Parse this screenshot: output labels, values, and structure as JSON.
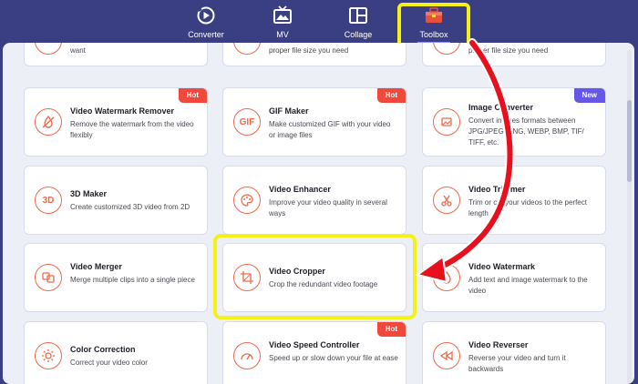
{
  "nav": {
    "items": [
      {
        "label": "Converter",
        "icon": "converter-icon"
      },
      {
        "label": "MV",
        "icon": "mv-icon"
      },
      {
        "label": "Collage",
        "icon": "collage-icon"
      },
      {
        "label": "Toolbox",
        "icon": "toolbox-icon",
        "active": true
      }
    ]
  },
  "top_row": [
    {
      "desc": "want"
    },
    {
      "desc": "proper file size you need"
    },
    {
      "desc": "proper file size you need"
    }
  ],
  "tools": [
    {
      "title": "Video Watermark Remover",
      "desc": "Remove the watermark from the video flexibly",
      "badge": "Hot",
      "icon": "watermark-remover-icon"
    },
    {
      "title": "GIF Maker",
      "desc": "Make customized GIF with your video or image files",
      "badge": "Hot",
      "icon": "gif-icon"
    },
    {
      "title": "Image Converter",
      "desc": "Convert images formats between JPG/JPEG, PNG, WEBP, BMP, TIF/ TIFF, etc.",
      "badge": "New",
      "icon": "image-converter-icon"
    },
    {
      "title": "3D Maker",
      "desc": "Create customized 3D video from 2D",
      "icon": "3d-icon"
    },
    {
      "title": "Video Enhancer",
      "desc": "Improve your video quality in several ways",
      "icon": "palette-icon"
    },
    {
      "title": "Video Trimmer",
      "desc": "Trim or cut your videos to the perfect length",
      "icon": "scissors-icon"
    },
    {
      "title": "Video Merger",
      "desc": "Merge multiple clips into a single piece",
      "icon": "merge-icon"
    },
    {
      "title": "Video Cropper",
      "desc": "Crop the redundant video footage",
      "icon": "crop-icon"
    },
    {
      "title": "Video Watermark",
      "desc": "Add text and image watermark to the video",
      "icon": "water-drop-icon"
    },
    {
      "title": "Color Correction",
      "desc": "Correct your video color",
      "icon": "sun-icon"
    },
    {
      "title": "Video Speed Controller",
      "desc": "Speed up or slow down your file at ease",
      "badge": "Hot",
      "icon": "speedometer-icon"
    },
    {
      "title": "Video Reverser",
      "desc": "Reverse your video and turn it backwards",
      "icon": "rewind-icon"
    }
  ],
  "icon_text": {
    "3d": "3D",
    "gif": "GIF"
  },
  "colors": {
    "nav_bg": "#3a3f83",
    "accent": "#ee6a4b",
    "hot": "#f0493c",
    "new": "#6657e8",
    "highlight": "#f3f01a",
    "arrow": "#e8101d"
  }
}
